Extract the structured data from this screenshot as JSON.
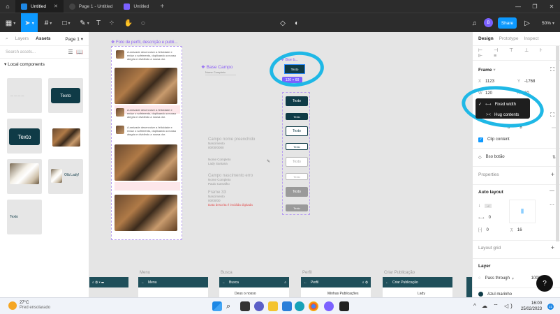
{
  "titlebar": {
    "tabs": [
      {
        "label": "Untitled",
        "active": true
      },
      {
        "label": "Page 1 - Untitled",
        "active": false
      },
      {
        "label": "Untitled",
        "active": false
      }
    ]
  },
  "toolbar": {
    "share_label": "Share",
    "avatar_initial": "B",
    "zoom": "50%"
  },
  "left_panel": {
    "tabs": [
      "Layers",
      "Assets"
    ],
    "page": "Page 1",
    "search_placeholder": "Search assets...",
    "section": "Local components",
    "thumb_button_label": "Texto",
    "thumb_small_label": "Texto",
    "thumb_greeting": "Olá Lady!"
  },
  "canvas": {
    "frame_title": "Foto de perfil, descrição e publi...",
    "post_text": "A amizade desenvolve a felicidade e reduz o sofrimento, duplicando a nossa alegria e dividindo a nossa dor.",
    "base_campo": "Base Campo",
    "base_campo_sub": "Nome Completo",
    "base_botao": "Bse b...",
    "selected_label": "Texto",
    "size_badge": "120 × 60",
    "forms": [
      {
        "title": "Campo nome preenchido",
        "lines": [
          "Nascimento",
          "00/00/0000"
        ]
      },
      {
        "title": "",
        "lines": [
          "Nome Completo",
          "Lady Santana"
        ]
      },
      {
        "title": "Campo nascimento erro",
        "lines": [
          "Nome Completo",
          "Paulo Carvalho"
        ]
      },
      {
        "title": "Frame 33",
        "lines": [
          "Nascimento",
          "00/00/00"
        ],
        "error": "Data descrita é inválida digitada"
      }
    ],
    "variant_label": "Texto",
    "bottom_frames": [
      {
        "label": "Menu",
        "header": "Menu"
      },
      {
        "label": "Busca",
        "header": "Busca",
        "extra": "Deus o nosso"
      },
      {
        "label": "Perfil",
        "header": "Perfil",
        "extra": "Minhas Publicações"
      },
      {
        "label": "Criar Publicação",
        "header": "Criar Publicação",
        "extra": "Lady"
      }
    ]
  },
  "right_panel": {
    "tabs": [
      "Design",
      "Prototype",
      "Inspect"
    ],
    "frame_section": "Frame",
    "x_label": "X",
    "x_value": "1123",
    "y_label": "Y",
    "y_value": "-1768",
    "w_label": "W",
    "w_value": "120",
    "h_label": "H",
    "h_value": "60",
    "dropdown": [
      "Fixed width",
      "Hug contents"
    ],
    "clip_content": "Clip content",
    "component": "Bso botão",
    "properties": "Properties",
    "auto_layout": "Auto layout",
    "spacing": "0",
    "padding_h": "0",
    "padding_v": "16",
    "layout_grid": "Layout grid",
    "layer": "Layer",
    "pass_through": "Pass through",
    "opacity": "100%",
    "fill": "Azul marinho"
  },
  "taskbar": {
    "weather_temp": "27°C",
    "weather_desc": "Pred ensolarado",
    "time": "16:00",
    "date": "25/02/2023",
    "badge": "21"
  }
}
